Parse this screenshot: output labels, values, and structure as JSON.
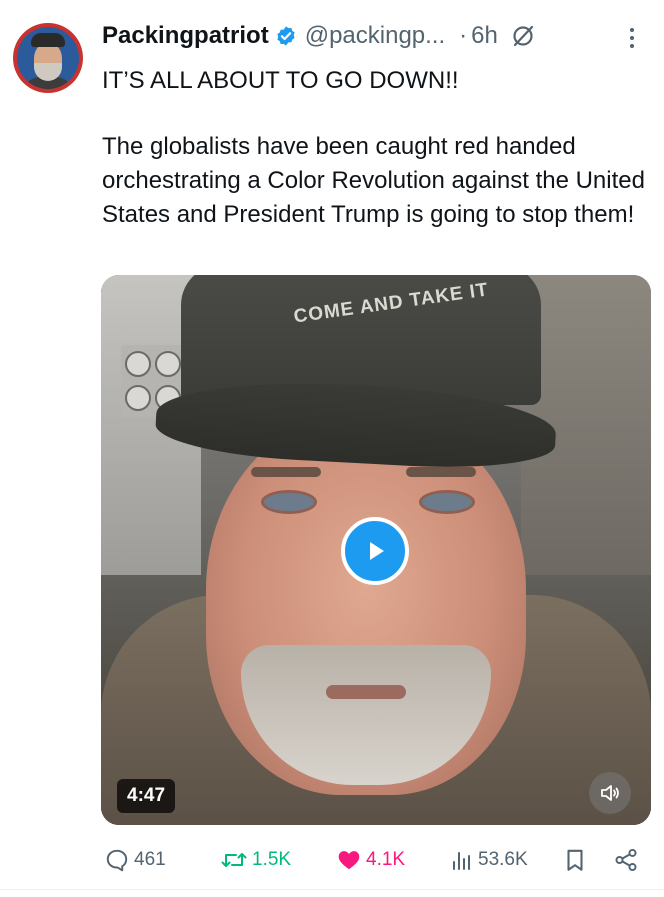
{
  "post": {
    "author": {
      "name": "Packingpatriot",
      "handle": "@packingp...",
      "time": "6h",
      "time_separator": "·"
    },
    "text_lines": [
      "IT’S ALL ABOUT TO GO DOWN!!",
      "The globalists have been caught red handed orchestrating a Color Revolution against the United States and President Trump is going to stop them!"
    ],
    "video": {
      "duration": "4:47",
      "cap_text": "COME AND TAKE IT"
    },
    "stats": {
      "replies": "461",
      "reposts": "1.5K",
      "likes": "4.1K",
      "views": "53.6K"
    }
  },
  "colors": {
    "accent": "#1d9bf0",
    "like": "#f91880",
    "repost": "#00ba7c",
    "muted": "#536471",
    "text": "#0f1419"
  },
  "icons": [
    "verified-badge-icon",
    "grok-icon",
    "more-icon",
    "play-icon",
    "mute-icon",
    "reply-icon",
    "repost-icon",
    "like-icon",
    "views-icon",
    "bookmark-icon",
    "share-icon"
  ]
}
